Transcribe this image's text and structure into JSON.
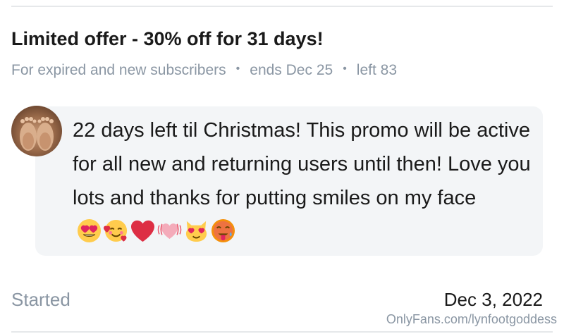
{
  "promo": {
    "title": "Limited offer - 30% off for 31 days!",
    "audience": "For expired and new subscribers",
    "ends": "ends Dec 25",
    "left": "left 83",
    "separator": "•"
  },
  "message": {
    "text": "22 days left til Christmas! This promo will be active for all new and returning users until then! Love you lots and thanks for putting smiles on my face",
    "emojis": [
      "heart-eyes-emoji",
      "smiling-hearts-emoji",
      "red-heart-emoji",
      "pink-heart-emoji",
      "cat-heart-eyes-emoji",
      "hot-face-emoji"
    ]
  },
  "footer": {
    "started_label": "Started",
    "started_date": "Dec 3, 2022",
    "watermark": "OnlyFans.com/lynfootgoddess"
  },
  "colors": {
    "muted": "#8a96a3",
    "bubble": "#f3f5f7",
    "divider": "#e6e8ea"
  }
}
